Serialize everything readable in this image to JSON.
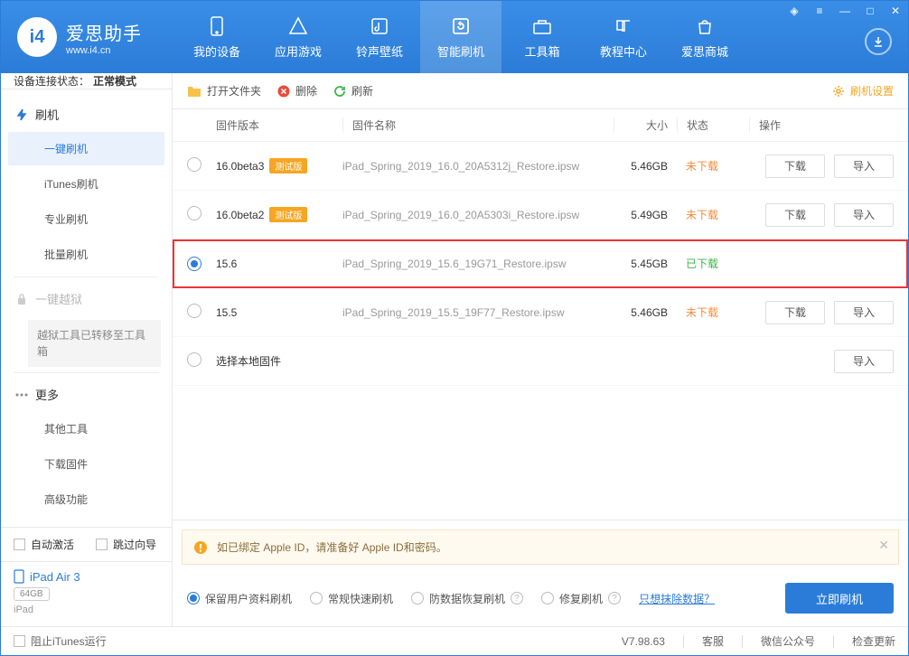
{
  "app": {
    "title": "爱思助手",
    "subtitle": "www.i4.cn"
  },
  "nav": {
    "items": [
      {
        "label": "我的设备"
      },
      {
        "label": "应用游戏"
      },
      {
        "label": "铃声壁纸"
      },
      {
        "label": "智能刷机"
      },
      {
        "label": "工具箱"
      },
      {
        "label": "教程中心"
      },
      {
        "label": "爱思商城"
      }
    ],
    "active_index": 3
  },
  "sidebar": {
    "status_label": "设备连接状态：",
    "status_mode": "正常模式",
    "flash_header": "刷机",
    "items": [
      {
        "label": "一键刷机"
      },
      {
        "label": "iTunes刷机"
      },
      {
        "label": "专业刷机"
      },
      {
        "label": "批量刷机"
      }
    ],
    "jailbreak_header": "一键越狱",
    "jailbreak_note": "越狱工具已转移至工具箱",
    "more_header": "更多",
    "more_items": [
      {
        "label": "其他工具"
      },
      {
        "label": "下载固件"
      },
      {
        "label": "高级功能"
      }
    ],
    "auto_activate": "自动激活",
    "skip_guide": "跳过向导",
    "device_name": "iPad Air 3",
    "device_capacity": "64GB",
    "device_type": "iPad"
  },
  "toolbar": {
    "open_folder": "打开文件夹",
    "delete": "删除",
    "refresh": "刷新",
    "settings": "刷机设置"
  },
  "columns": {
    "version": "固件版本",
    "name": "固件名称",
    "size": "大小",
    "status": "状态",
    "ops": "操作"
  },
  "rows": [
    {
      "version": "16.0beta3",
      "beta": "测试版",
      "name": "iPad_Spring_2019_16.0_20A5312j_Restore.ipsw",
      "size": "5.46GB",
      "status": "未下载",
      "status_kind": "nd",
      "selected": false,
      "download": "下载",
      "import": "导入"
    },
    {
      "version": "16.0beta2",
      "beta": "测试版",
      "name": "iPad_Spring_2019_16.0_20A5303i_Restore.ipsw",
      "size": "5.49GB",
      "status": "未下载",
      "status_kind": "nd",
      "selected": false,
      "download": "下载",
      "import": "导入"
    },
    {
      "version": "15.6",
      "beta": "",
      "name": "iPad_Spring_2019_15.6_19G71_Restore.ipsw",
      "size": "5.45GB",
      "status": "已下载",
      "status_kind": "dl",
      "selected": true,
      "highlight": true
    },
    {
      "version": "15.5",
      "beta": "",
      "name": "iPad_Spring_2019_15.5_19F77_Restore.ipsw",
      "size": "5.46GB",
      "status": "未下载",
      "status_kind": "nd",
      "selected": false,
      "download": "下载",
      "import": "导入"
    },
    {
      "version": "选择本地固件",
      "beta": "",
      "name": "",
      "size": "",
      "status": "",
      "status_kind": "",
      "selected": false,
      "import": "导入"
    }
  ],
  "warn": "如已绑定 Apple ID，请准备好 Apple ID和密码。",
  "options": {
    "keep_data": "保留用户资料刷机",
    "normal": "常规快速刷机",
    "anti_recover": "防数据恢复刷机",
    "repair": "修复刷机",
    "erase_link": "只想抹除数据？",
    "go": "立即刷机"
  },
  "footer": {
    "block_itunes": "阻止iTunes运行",
    "version": "V7.98.63",
    "support": "客服",
    "wechat": "微信公众号",
    "update": "检查更新"
  }
}
